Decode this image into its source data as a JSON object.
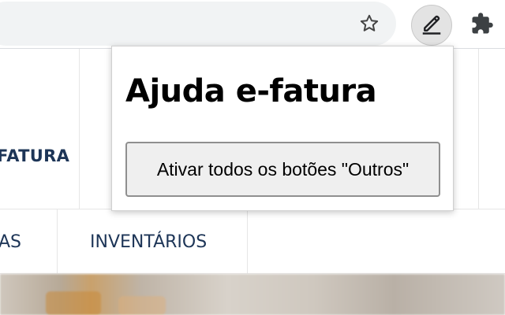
{
  "toolbar": {
    "bookmark_icon": "star-outline-icon",
    "extensions": [
      {
        "name": "Ajuda e-fatura",
        "icon": "pen-underline-icon",
        "active": true
      },
      {
        "name": "Extensions",
        "icon": "puzzle-icon",
        "active": false
      }
    ]
  },
  "page": {
    "nav_top_item": "FATURA",
    "nav_items": [
      "AS",
      "INVENTÁRIOS"
    ],
    "brand_color": "#1d3557"
  },
  "popup": {
    "title": "Ajuda e-fatura",
    "button_label": "Ativar todos os botões \"Outros\""
  }
}
